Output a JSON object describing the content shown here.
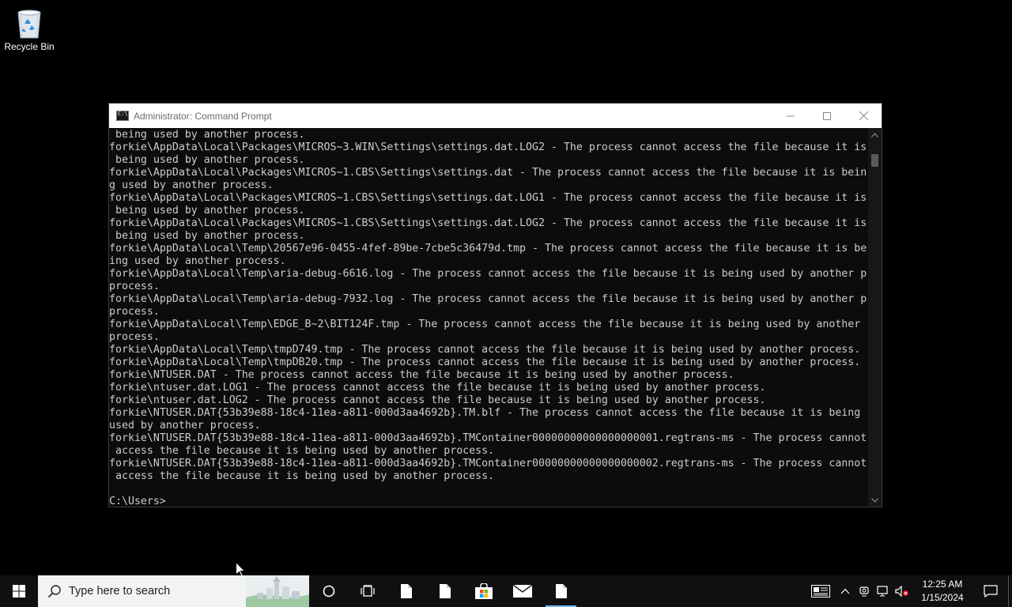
{
  "desktop": {
    "recycle_bin_label": "Recycle Bin",
    "recycle_bin_icon": "recycle-bin-icon"
  },
  "window": {
    "title": "Administrator: Command Prompt",
    "controls": [
      "minimize-icon",
      "maximize-icon",
      "close-icon"
    ]
  },
  "console": {
    "lines": [
      " being used by another process.",
      "forkie\\AppData\\Local\\Packages\\MICROS~3.WIN\\Settings\\settings.dat.LOG2 - The process cannot access the file because it is",
      " being used by another process.",
      "forkie\\AppData\\Local\\Packages\\MICROS~1.CBS\\Settings\\settings.dat - The process cannot access the file because it is bein",
      "g used by another process.",
      "forkie\\AppData\\Local\\Packages\\MICROS~1.CBS\\Settings\\settings.dat.LOG1 - The process cannot access the file because it is",
      " being used by another process.",
      "forkie\\AppData\\Local\\Packages\\MICROS~1.CBS\\Settings\\settings.dat.LOG2 - The process cannot access the file because it is",
      " being used by another process.",
      "forkie\\AppData\\Local\\Temp\\20567e96-0455-4fef-89be-7cbe5c36479d.tmp - The process cannot access the file because it is be",
      "ing used by another process.",
      "forkie\\AppData\\Local\\Temp\\aria-debug-6616.log - The process cannot access the file because it is being used by another p",
      "process.",
      "forkie\\AppData\\Local\\Temp\\aria-debug-7932.log - The process cannot access the file because it is being used by another p",
      "process.",
      "forkie\\AppData\\Local\\Temp\\EDGE_B~2\\BIT124F.tmp - The process cannot access the file because it is being used by another",
      "process.",
      "forkie\\AppData\\Local\\Temp\\tmpD749.tmp - The process cannot access the file because it is being used by another process.",
      "forkie\\AppData\\Local\\Temp\\tmpDB20.tmp - The process cannot access the file because it is being used by another process.",
      "forkie\\NTUSER.DAT - The process cannot access the file because it is being used by another process.",
      "forkie\\ntuser.dat.LOG1 - The process cannot access the file because it is being used by another process.",
      "forkie\\ntuser.dat.LOG2 - The process cannot access the file because it is being used by another process.",
      "forkie\\NTUSER.DAT{53b39e88-18c4-11ea-a811-000d3aa4692b}.TM.blf - The process cannot access the file because it is being",
      "used by another process.",
      "forkie\\NTUSER.DAT{53b39e88-18c4-11ea-a811-000d3aa4692b}.TMContainer00000000000000000001.regtrans-ms - The process cannot",
      " access the file because it is being used by another process.",
      "forkie\\NTUSER.DAT{53b39e88-18c4-11ea-a811-000d3aa4692b}.TMContainer00000000000000000002.regtrans-ms - The process cannot",
      " access the file because it is being used by another process.",
      "",
      "C:\\Users>"
    ]
  },
  "taskbar": {
    "search_placeholder": "Type here to search",
    "pinned": [
      "cortana-icon",
      "task-view-icon",
      "file-icon",
      "file-icon",
      "store-icon",
      "mail-icon",
      "file-icon"
    ],
    "clock_time": "12:25 AM",
    "clock_date": "1/15/2024",
    "accent_color": "#76b9ed"
  }
}
